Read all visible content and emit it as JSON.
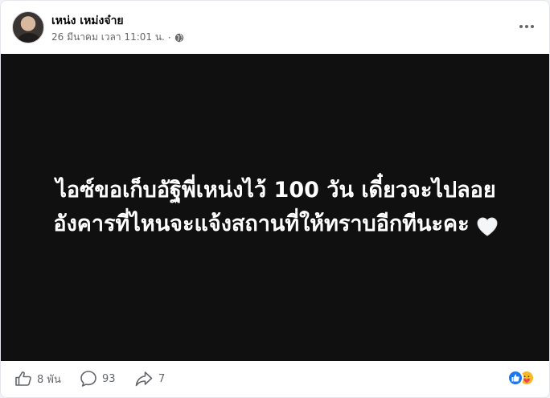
{
  "post": {
    "author": "เหน่ง เหม่งจ๋าย",
    "timestamp": "26 มีนาคม เวลา 11:01 น.",
    "separator": "·",
    "audience_icon": "globe-icon",
    "more_icon": "more-options-icon"
  },
  "media": {
    "line1": "ไอซ์ขอเก็บอัฐิพี่เหน่งไว้ 100 วัน เดี๋ยวจะไปลอย",
    "line2": "อังคารที่ไหนจะแจ้งสถานที่ให้ทราบอีกทีนะคะ",
    "emoji_icon": "white-heart-icon"
  },
  "stats": {
    "likes": "8 พัน",
    "comments": "93",
    "shares": "7"
  },
  "reactions": [
    "like-reaction-icon",
    "care-reaction-icon"
  ],
  "colors": {
    "media_bg": "#101010",
    "text_primary": "#050505",
    "text_secondary": "#65676b",
    "like_blue": "#1877f2"
  }
}
